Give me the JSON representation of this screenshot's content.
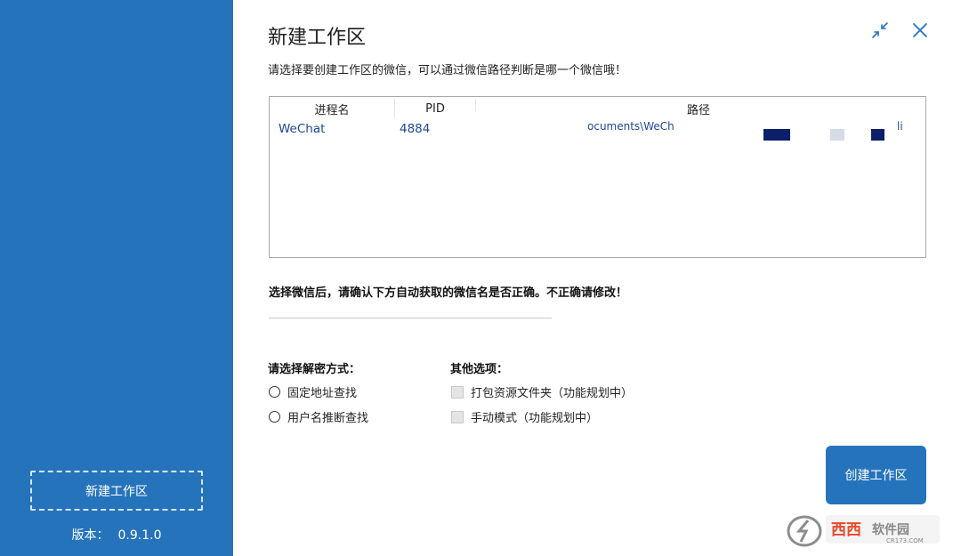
{
  "sidebar": {
    "new_workspace_label": "新建工作区",
    "version_label": "版本：",
    "version_value": "0.9.1.0"
  },
  "header": {
    "title": "新建工作区",
    "subtitle": "请选择要创建工作区的微信，可以通过微信路径判断是哪一个微信哦！",
    "shrink_icon": "shrink-arrows-icon",
    "close_icon": "close-icon"
  },
  "process_table": {
    "columns": [
      "进程名",
      "PID",
      "路径"
    ],
    "rows": [
      {
        "name": "WeChat",
        "pid": "4884",
        "path": "ocuments\\WeCh"
      }
    ],
    "path_suffix_fragment": "li"
  },
  "name_section": {
    "notice": "选择微信后，请确认下方自动获取的微信名是否正确。不正确请修改！",
    "value": ""
  },
  "decrypt": {
    "title": "请选择解密方式：",
    "options": [
      "固定地址查找",
      "用户名推断查找"
    ]
  },
  "other": {
    "title": "其他选项：",
    "options": [
      "打包资源文件夹（功能规划中）",
      "手动模式（功能规划中）"
    ]
  },
  "create_button_label": "创建工作区",
  "watermark": {
    "brand": "西西软件园",
    "domain": "CR173.COM"
  },
  "colors": {
    "accent": "#2574bb",
    "table_text": "#1b4796",
    "redaction_navy": "#0c1f6b"
  }
}
